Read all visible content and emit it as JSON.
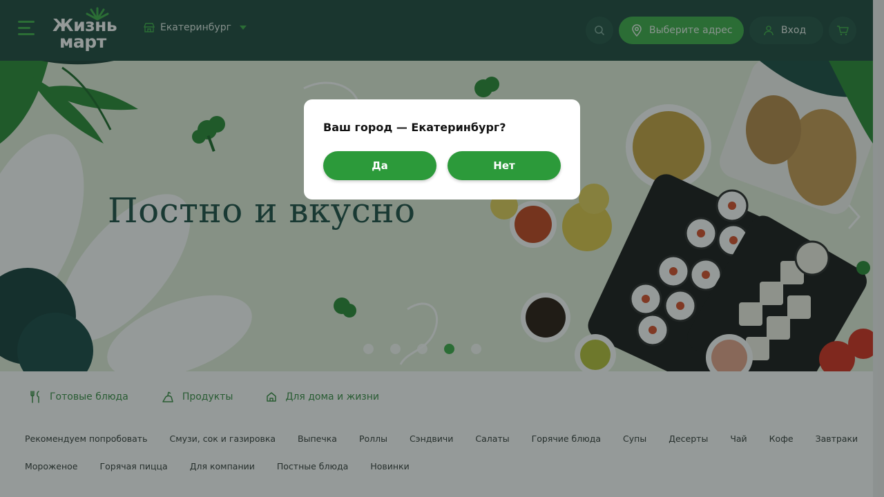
{
  "header": {
    "logo_line1": "Жизнь",
    "logo_line2": "март",
    "city": "Екатеринбург",
    "address_label": "Выберите адрес",
    "login_label": "Вход",
    "icons": [
      "menu-icon",
      "store-icon",
      "search-icon",
      "location-pin-icon",
      "user-icon",
      "cart-icon"
    ]
  },
  "banner": {
    "title": "Постно и вкусно",
    "slides_count": 5,
    "active_slide": 4
  },
  "categories": [
    {
      "label": "Готовые блюда",
      "icon": "fork-knife-icon"
    },
    {
      "label": "Продукты",
      "icon": "products-icon"
    },
    {
      "label": "Для дома и жизни",
      "icon": "home-icon"
    }
  ],
  "subcategories_row1": [
    "Рекомендуем попробовать",
    "Смузи, сок и газировка",
    "Выпечка",
    "Роллы",
    "Сэндвичи",
    "Салаты",
    "Горячие блюда",
    "Супы",
    "Десерты",
    "Чай",
    "Кофе",
    "Завтраки"
  ],
  "subcategories_row2": [
    "Мороженое",
    "Горячая пицца",
    "Для компании",
    "Постные блюда",
    "Новинки"
  ],
  "modal": {
    "question": "Ваш город — Екатеринбург?",
    "yes_label": "Да",
    "no_label": "Нет"
  },
  "colors": {
    "header_bg": "#1f4a3f",
    "brand_green": "#3fae49",
    "button_green": "#2c9a3a",
    "banner_bg": "#e3efdb"
  }
}
